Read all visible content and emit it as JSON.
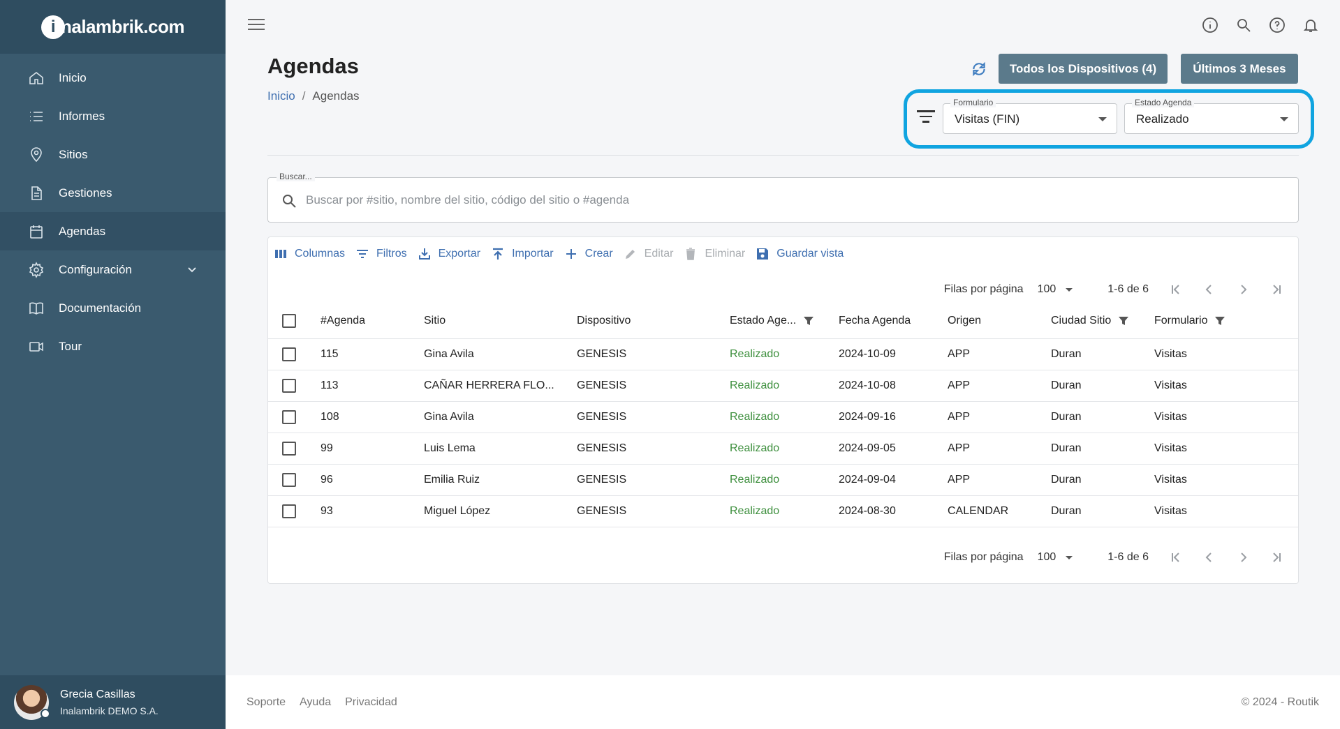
{
  "brand": {
    "logo_i": "i",
    "logo_text": "nalambrik.com"
  },
  "sidebar": {
    "items": [
      {
        "label": "Inicio",
        "icon": "home-icon"
      },
      {
        "label": "Informes",
        "icon": "list-icon"
      },
      {
        "label": "Sitios",
        "icon": "location-pin-icon"
      },
      {
        "label": "Gestiones",
        "icon": "document-icon"
      },
      {
        "label": "Agendas",
        "icon": "calendar-icon",
        "active": true
      },
      {
        "label": "Configuración",
        "icon": "gear-icon",
        "expandable": true
      },
      {
        "label": "Documentación",
        "icon": "book-icon"
      },
      {
        "label": "Tour",
        "icon": "video-icon"
      }
    ],
    "user": {
      "name": "Grecia Casillas",
      "org": "Inalambrik DEMO S.A."
    }
  },
  "header": {
    "title": "Agendas",
    "breadcrumb": {
      "home": "Inicio",
      "separator": "/",
      "current": "Agendas"
    },
    "btn_devices": "Todos los Dispositivos (4)",
    "btn_months": "Últimos 3 Meses"
  },
  "filters": {
    "formulario": {
      "label": "Formulario",
      "value": "Visitas (FIN)"
    },
    "estado": {
      "label": "Estado Agenda",
      "value": "Realizado"
    }
  },
  "search": {
    "label": "Buscar...",
    "placeholder": "Buscar por #sitio, nombre del sitio, código del sitio o #agenda"
  },
  "toolbar": {
    "columns": "Columnas",
    "filters": "Filtros",
    "export": "Exportar",
    "import": "Importar",
    "create": "Crear",
    "edit": "Editar",
    "delete": "Eliminar",
    "save_view": "Guardar vista"
  },
  "pagination": {
    "rows_label": "Filas por página",
    "rows_value": "100",
    "range": "1-6 de 6"
  },
  "table": {
    "headers": {
      "id": "#Agenda",
      "sitio": "Sitio",
      "dispositivo": "Dispositivo",
      "estado": "Estado Age...",
      "fecha": "Fecha Agenda",
      "origen": "Origen",
      "ciudad": "Ciudad Sitio",
      "formulario": "Formulario"
    },
    "rows": [
      {
        "id": "115",
        "sitio": "Gina Avila",
        "dispositivo": "GENESIS",
        "estado": "Realizado",
        "fecha": "2024-10-09",
        "origen": "APP",
        "ciudad": "Duran",
        "formulario": "Visitas"
      },
      {
        "id": "113",
        "sitio": "CAÑAR HERRERA FLO...",
        "dispositivo": "GENESIS",
        "estado": "Realizado",
        "fecha": "2024-10-08",
        "origen": "APP",
        "ciudad": "Duran",
        "formulario": "Visitas"
      },
      {
        "id": "108",
        "sitio": "Gina Avila",
        "dispositivo": "GENESIS",
        "estado": "Realizado",
        "fecha": "2024-09-16",
        "origen": "APP",
        "ciudad": "Duran",
        "formulario": "Visitas"
      },
      {
        "id": "99",
        "sitio": "Luis Lema",
        "dispositivo": "GENESIS",
        "estado": "Realizado",
        "fecha": "2024-09-05",
        "origen": "APP",
        "ciudad": "Duran",
        "formulario": "Visitas"
      },
      {
        "id": "96",
        "sitio": "Emilia Ruiz",
        "dispositivo": "GENESIS",
        "estado": "Realizado",
        "fecha": "2024-09-04",
        "origen": "APP",
        "ciudad": "Duran",
        "formulario": "Visitas"
      },
      {
        "id": "93",
        "sitio": "Miguel López",
        "dispositivo": "GENESIS",
        "estado": "Realizado",
        "fecha": "2024-08-30",
        "origen": "CALENDAR",
        "ciudad": "Duran",
        "formulario": "Visitas"
      }
    ]
  },
  "footer": {
    "links": [
      "Soporte",
      "Ayuda",
      "Privacidad"
    ],
    "copyright": "© 2024 - Routik"
  },
  "colors": {
    "sidebar": "#3a5a6e",
    "accent": "#3f6fb0",
    "highlight": "#10a4e0",
    "status_ok": "#3d8f3d",
    "button": "#5b7a8b"
  }
}
